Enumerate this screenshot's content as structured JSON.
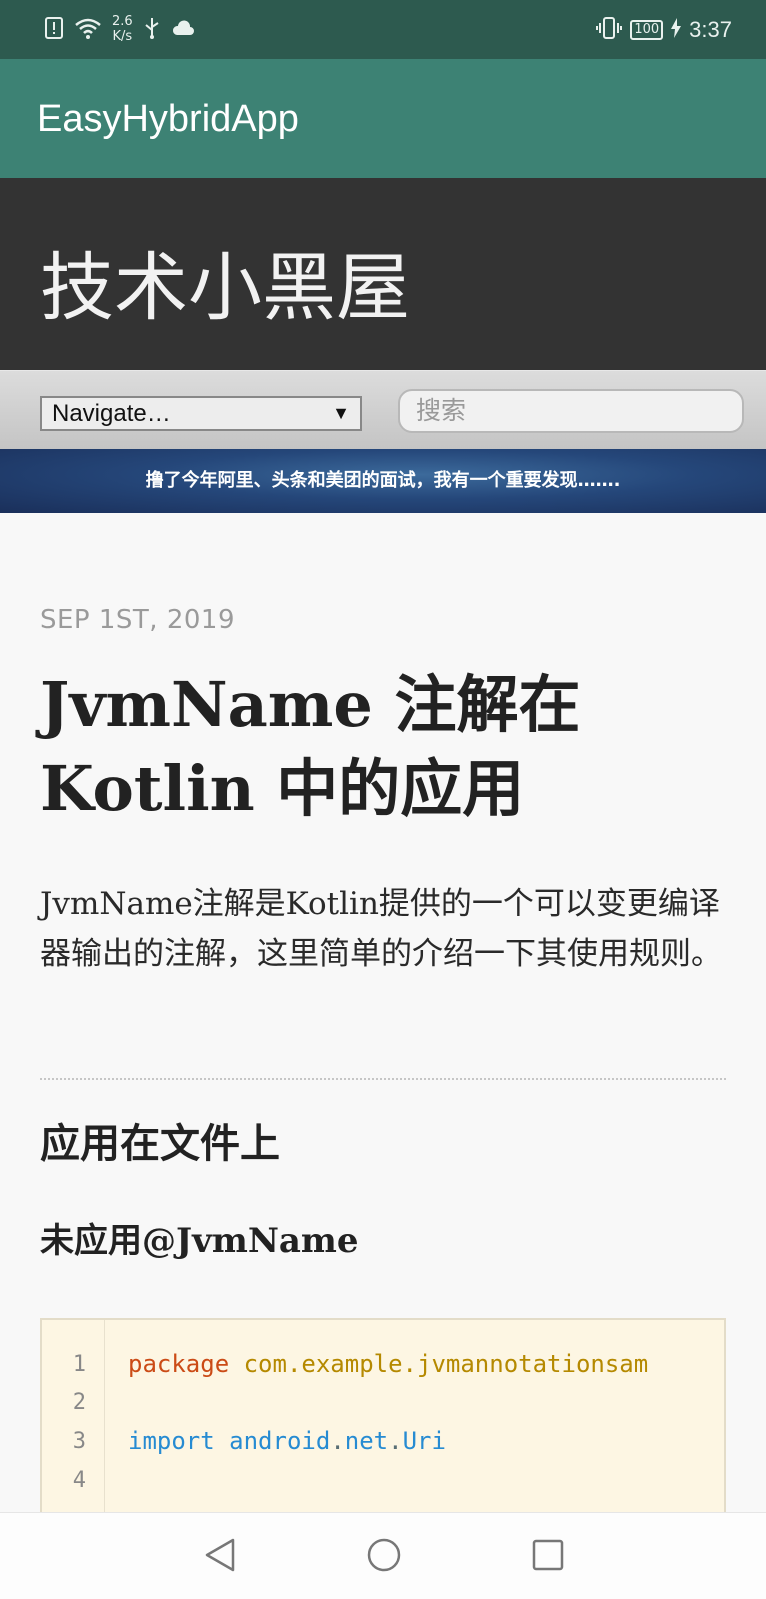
{
  "status_bar": {
    "network_speed_value": "2.6",
    "network_speed_unit": "K/s",
    "battery": "100",
    "time": "3:37",
    "icons": [
      "alert-icon",
      "wifi-icon",
      "usb-icon",
      "cloud-icon",
      "vibrate-icon",
      "battery-icon",
      "charging-icon"
    ]
  },
  "app_bar": {
    "title": "EasyHybridApp"
  },
  "blog_header": {
    "title": "技术小黑屋"
  },
  "nav": {
    "select_value": "Navigate…",
    "search_placeholder": "搜索"
  },
  "banner": {
    "text": "撸了今年阿里、头条和美团的面试，我有一个重要发现……."
  },
  "post": {
    "date": "SEP 1ST, 2019",
    "title": "JvmName 注解在 Kotlin 中的应用",
    "intro": "JvmName注解是Kotlin提供的一个可以变更编译器输出的注解，这里简单的介绍一下其使用规则。",
    "h2": "应用在文件上",
    "h3": "未应用@JvmName"
  },
  "code": {
    "line_numbers": [
      "1",
      "2",
      "3",
      "4"
    ],
    "line1_keyword": "package",
    "line1_value": "com.example.jvmannotationsam",
    "line3_keyword": "import",
    "line3_value_a": "android",
    "line3_value_b": "net",
    "line3_value_c": "Uri",
    "dot": "."
  },
  "colors": {
    "status_bar": "#2d5a4f",
    "app_bar": "#3d8274",
    "blog_header": "#333333",
    "code_bg": "#fdf6e3"
  },
  "system_nav": {
    "icons": [
      "back-icon",
      "home-icon",
      "recents-icon"
    ]
  }
}
